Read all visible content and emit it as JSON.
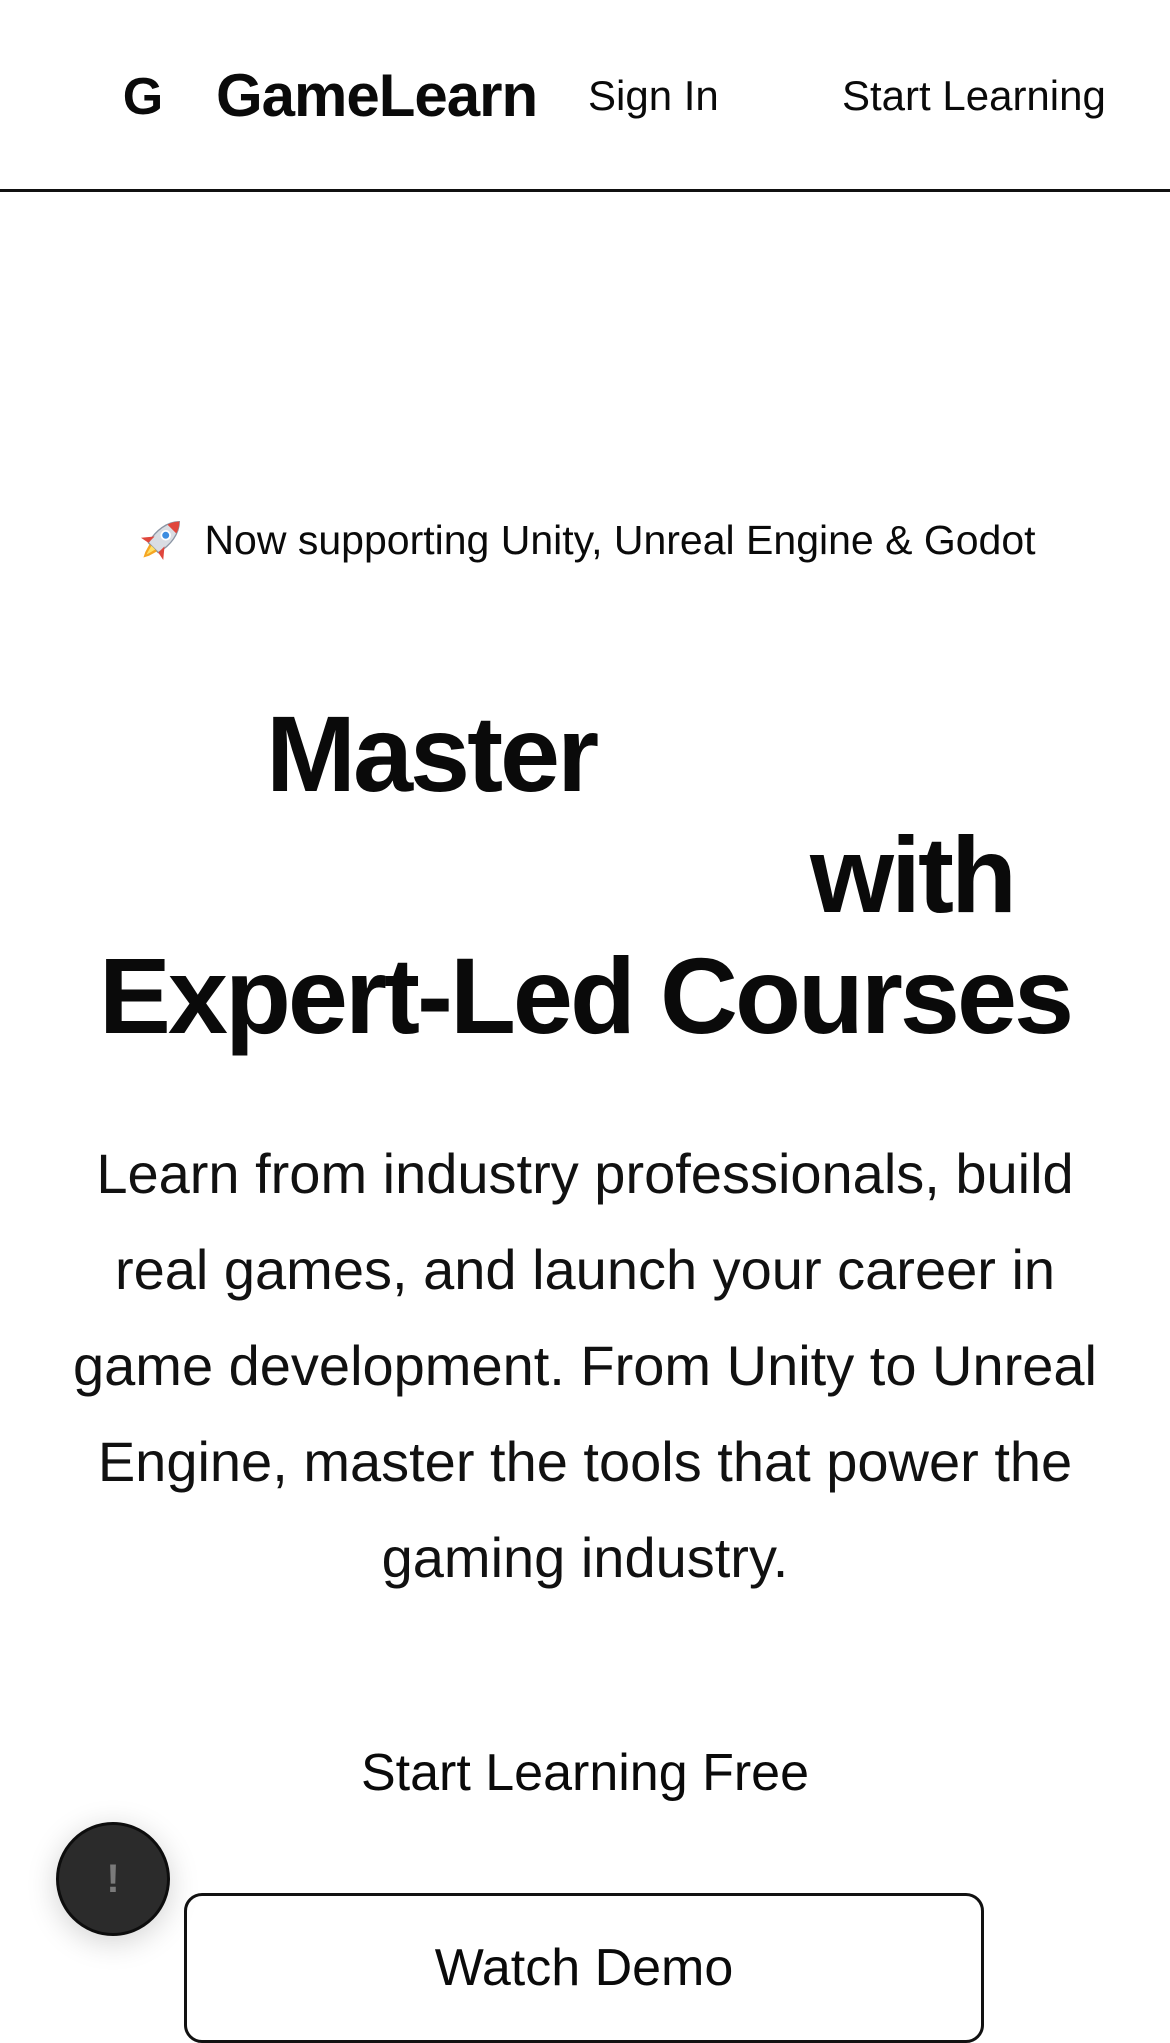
{
  "header": {
    "logo_letter": "G",
    "brand_name": "GameLearn",
    "sign_in_label": "Sign In",
    "start_learning_label": "Start Learning"
  },
  "hero": {
    "announcement_icon": "rocket-icon",
    "announcement_text": "Now supporting Unity, Unreal Engine & Godot",
    "headline_line1": "Master",
    "headline_line2": "with",
    "headline_line3": "Expert-Led Courses",
    "description": "Learn from industry professionals, build real games, and launch your career in game development. From Unity to Unreal Engine, master the tools that power the gaming industry.",
    "primary_cta_label": "Start Learning Free",
    "secondary_cta_label": "Watch Demo"
  },
  "floating_button": {
    "icon": "alert-icon",
    "glyph": "!"
  },
  "colors": {
    "text": "#0a0a0a",
    "background": "#ffffff",
    "border": "#111111",
    "fab_background": "#2b2b2b"
  }
}
